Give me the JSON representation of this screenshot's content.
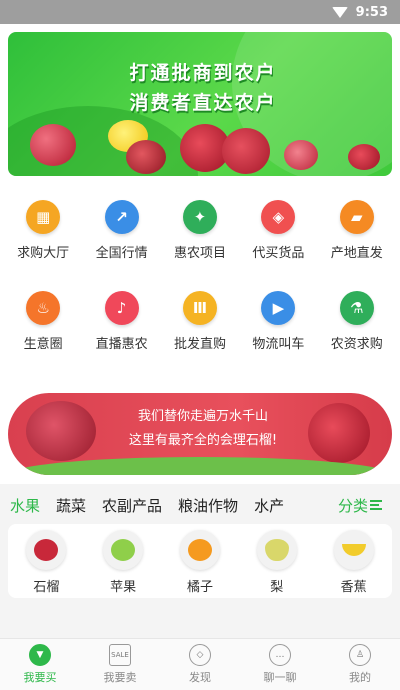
{
  "status_bar": {
    "time": "9:53"
  },
  "banner": {
    "line1": "打通批商到农户",
    "line2": "消费者直达农户"
  },
  "quick_grid": {
    "row1": [
      {
        "label": "求购大厅",
        "icon": "storefront-icon",
        "color": "#f5a623",
        "glyph": "▦"
      },
      {
        "label": "全国行情",
        "icon": "trend-chart-icon",
        "color": "#3a8ee6",
        "glyph": "↗"
      },
      {
        "label": "惠农项目",
        "icon": "handshake-icon",
        "color": "#2fae5a",
        "glyph": "✦"
      },
      {
        "label": "代买货品",
        "icon": "package-icon",
        "color": "#f05050",
        "glyph": "◈"
      },
      {
        "label": "产地直发",
        "icon": "truck-icon",
        "color": "#f58a23",
        "glyph": "▰"
      }
    ],
    "row2": [
      {
        "label": "生意圈",
        "icon": "flame-icon",
        "color": "#f5752a",
        "glyph": "♨"
      },
      {
        "label": "直播惠农",
        "icon": "microphone-icon",
        "color": "#f0485a",
        "glyph": "♪"
      },
      {
        "label": "批发直购",
        "icon": "wholesale-icon",
        "color": "#f5b323",
        "glyph": "Ⅲ"
      },
      {
        "label": "物流叫车",
        "icon": "delivery-truck-icon",
        "color": "#3a8ee6",
        "glyph": "▶"
      },
      {
        "label": "农资求购",
        "icon": "fertilizer-icon",
        "color": "#2fae5a",
        "glyph": "⚗"
      }
    ]
  },
  "promo": {
    "line1": "我们替你走遍万水千山",
    "line2": "这里有最齐全的会理石榴!"
  },
  "categories": {
    "tabs": [
      "水果",
      "蔬菜",
      "农副产品",
      "粮油作物",
      "水产"
    ],
    "active_index": 0,
    "more_label": "分类"
  },
  "fruits": [
    {
      "label": "石榴",
      "color": "#c8283a"
    },
    {
      "label": "苹果",
      "color": "#8fcf4a"
    },
    {
      "label": "橘子",
      "color": "#f59a1f"
    },
    {
      "label": "梨",
      "color": "#d9d76a"
    },
    {
      "label": "香蕉",
      "color": "#f2cc2c"
    }
  ],
  "tabbar": [
    {
      "label": "我要买",
      "icon": "cart-icon",
      "glyph": "▼",
      "active": true
    },
    {
      "label": "我要卖",
      "icon": "sale-tag-icon",
      "glyph": "SALE",
      "active": false
    },
    {
      "label": "发现",
      "icon": "compass-icon",
      "glyph": "◇",
      "active": false
    },
    {
      "label": "聊一聊",
      "icon": "chat-bubble-icon",
      "glyph": "…",
      "active": false
    },
    {
      "label": "我的",
      "icon": "user-icon",
      "glyph": "♙",
      "active": false
    }
  ]
}
